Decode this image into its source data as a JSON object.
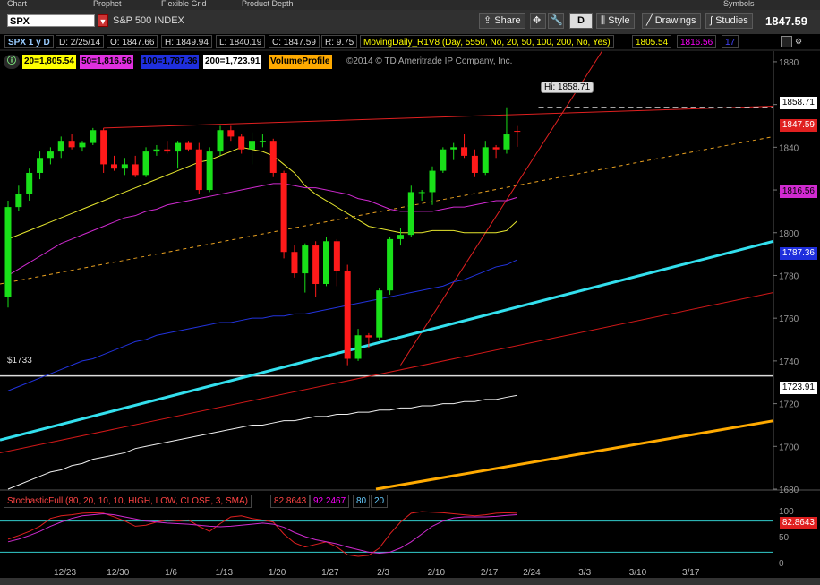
{
  "tabs": [
    "Chart",
    "Prophet",
    "Flexible Grid",
    "Product Depth",
    "Symbols"
  ],
  "toolbar": {
    "symbol": "SPX",
    "symbol_name": "S&P 500 INDEX",
    "share_label": "Share",
    "d_label": "D",
    "style_label": "Style",
    "drawings_label": "Drawings",
    "studies_label": "Studies",
    "last_price": "1847.59"
  },
  "infobar": {
    "symbol_period": "SPX 1 y D",
    "date": "D: 2/25/14",
    "open": "O: 1847.66",
    "high": "H: 1849.94",
    "low": "L: 1840.19",
    "close": "C: 1847.59",
    "range": "R: 9.75",
    "study": "MovingDaily_R1V8 (Day, 5550, No, 20, 50, 100, 200, No, Yes)",
    "ma_a": "1805.54",
    "ma_b": "1816.56",
    "ma_c": "17"
  },
  "study_labels": {
    "ma20": "20=1,805.54",
    "ma50": "50=1,816.56",
    "ma100": "100=1,787.36",
    "ma200": "200=1,723.91",
    "volume_profile": "VolumeProfile",
    "copyright": "©2014 © TD Ameritrade IP Company, Inc."
  },
  "annotations": {
    "high_bubble": "Hi: 1858.71",
    "level_label": "$1733"
  },
  "price_labels": {
    "hi": "1858.71",
    "last": "1847.59",
    "ma50": "1816.56",
    "ma100": "1787.36",
    "ma200": "1723.91",
    "stoch": "82.8643"
  },
  "stochastic": {
    "name": "StochasticFull (80, 20, 10, 10, HIGH, LOW, CLOSE, 3, SMA)",
    "k": "82.8643",
    "d": "92.2467",
    "over_bought": "80",
    "over_sold": "20"
  },
  "colors": {
    "up": "#19e019",
    "down": "#ff1a1a",
    "ma20": "#e6e62e",
    "ma50": "#d02ad0",
    "ma100": "#2233dd",
    "ma200": "#f0f0f0",
    "cyan": "#33e0ee",
    "orange": "#ffaa00"
  },
  "chart_data": {
    "type": "candlestick",
    "symbol": "SPX",
    "ylim": [
      1680,
      1885
    ],
    "y_ticks": [
      1680,
      1700,
      1720,
      1740,
      1760,
      1780,
      1800,
      1820,
      1840,
      1860,
      1880
    ],
    "x_tick_labels": [
      "12/23",
      "12/30",
      "1/6",
      "1/13",
      "1/20",
      "1/27",
      "2/3",
      "2/10",
      "2/17",
      "2/24",
      "3/3",
      "3/10",
      "3/17"
    ],
    "candles": [
      {
        "o": 1770,
        "c": 1812,
        "h": 1815,
        "l": 1765
      },
      {
        "o": 1812,
        "c": 1818,
        "h": 1822,
        "l": 1810
      },
      {
        "o": 1818,
        "c": 1828,
        "h": 1830,
        "l": 1815
      },
      {
        "o": 1828,
        "c": 1835,
        "h": 1838,
        "l": 1825
      },
      {
        "o": 1835,
        "c": 1838,
        "h": 1840,
        "l": 1832
      },
      {
        "o": 1838,
        "c": 1843,
        "h": 1845,
        "l": 1835
      },
      {
        "o": 1843,
        "c": 1840,
        "h": 1846,
        "l": 1839
      },
      {
        "o": 1840,
        "c": 1842,
        "h": 1843,
        "l": 1838
      },
      {
        "o": 1842,
        "c": 1848,
        "h": 1849,
        "l": 1841
      },
      {
        "o": 1848,
        "c": 1832,
        "h": 1849,
        "l": 1828
      },
      {
        "o": 1832,
        "c": 1830,
        "h": 1836,
        "l": 1829
      },
      {
        "o": 1830,
        "c": 1832,
        "h": 1835,
        "l": 1827
      },
      {
        "o": 1832,
        "c": 1827,
        "h": 1836,
        "l": 1826
      },
      {
        "o": 1827,
        "c": 1838,
        "h": 1840,
        "l": 1826
      },
      {
        "o": 1838,
        "c": 1839,
        "h": 1841,
        "l": 1836
      },
      {
        "o": 1839,
        "c": 1838,
        "h": 1843,
        "l": 1837
      },
      {
        "o": 1838,
        "c": 1842,
        "h": 1843,
        "l": 1830
      },
      {
        "o": 1842,
        "c": 1839,
        "h": 1843,
        "l": 1838
      },
      {
        "o": 1839,
        "c": 1820,
        "h": 1842,
        "l": 1818
      },
      {
        "o": 1820,
        "c": 1838,
        "h": 1840,
        "l": 1819
      },
      {
        "o": 1838,
        "c": 1848,
        "h": 1850,
        "l": 1836
      },
      {
        "o": 1848,
        "c": 1845,
        "h": 1850,
        "l": 1843
      },
      {
        "o": 1845,
        "c": 1839,
        "h": 1846,
        "l": 1837
      },
      {
        "o": 1839,
        "c": 1843,
        "h": 1847,
        "l": 1832
      },
      {
        "o": 1843,
        "c": 1843,
        "h": 1846,
        "l": 1840
      },
      {
        "o": 1843,
        "c": 1828,
        "h": 1844,
        "l": 1826
      },
      {
        "o": 1828,
        "c": 1791,
        "h": 1829,
        "l": 1788
      },
      {
        "o": 1791,
        "c": 1781,
        "h": 1794,
        "l": 1779
      },
      {
        "o": 1781,
        "c": 1794,
        "h": 1795,
        "l": 1772
      },
      {
        "o": 1794,
        "c": 1776,
        "h": 1796,
        "l": 1770
      },
      {
        "o": 1776,
        "c": 1796,
        "h": 1798,
        "l": 1775
      },
      {
        "o": 1796,
        "c": 1782,
        "h": 1797,
        "l": 1775
      },
      {
        "o": 1782,
        "c": 1741,
        "h": 1785,
        "l": 1738
      },
      {
        "o": 1741,
        "c": 1752,
        "h": 1755,
        "l": 1740
      },
      {
        "o": 1752,
        "c": 1751,
        "h": 1753,
        "l": 1746
      },
      {
        "o": 1751,
        "c": 1773,
        "h": 1774,
        "l": 1750
      },
      {
        "o": 1773,
        "c": 1797,
        "h": 1798,
        "l": 1771
      },
      {
        "o": 1797,
        "c": 1799,
        "h": 1802,
        "l": 1794
      },
      {
        "o": 1799,
        "c": 1819,
        "h": 1822,
        "l": 1798
      },
      {
        "o": 1819,
        "c": 1819,
        "h": 1820,
        "l": 1815
      },
      {
        "o": 1819,
        "c": 1829,
        "h": 1831,
        "l": 1813
      },
      {
        "o": 1829,
        "c": 1839,
        "h": 1840,
        "l": 1828
      },
      {
        "o": 1839,
        "c": 1840,
        "h": 1842,
        "l": 1834
      },
      {
        "o": 1840,
        "c": 1836,
        "h": 1846,
        "l": 1835
      },
      {
        "o": 1836,
        "c": 1828,
        "h": 1839,
        "l": 1826
      },
      {
        "o": 1828,
        "c": 1840,
        "h": 1843,
        "l": 1827
      },
      {
        "o": 1840,
        "c": 1839,
        "h": 1841,
        "l": 1835
      },
      {
        "o": 1839,
        "c": 1846,
        "h": 1858.71,
        "l": 1837
      },
      {
        "o": 1847.66,
        "c": 1847.59,
        "h": 1849.94,
        "l": 1840.19
      }
    ],
    "moving_averages": [
      {
        "name": "20",
        "values": [
          1797,
          1799,
          1801,
          1803,
          1805,
          1807,
          1809,
          1811,
          1813,
          1815,
          1817,
          1819,
          1821,
          1823,
          1825,
          1827,
          1829,
          1831,
          1833,
          1834,
          1836,
          1838,
          1840,
          1839,
          1838,
          1836,
          1832,
          1828,
          1822,
          1818,
          1815,
          1812,
          1809,
          1806,
          1803,
          1802,
          1801,
          1800,
          1800,
          1800,
          1801,
          1801,
          1801,
          1800,
          1800,
          1800,
          1800,
          1801,
          1805.54
        ]
      },
      {
        "name": "50",
        "values": [
          1780,
          1783,
          1786,
          1789,
          1792,
          1795,
          1797,
          1799,
          1801,
          1803,
          1805,
          1807,
          1808,
          1810,
          1811,
          1813,
          1814,
          1815,
          1816,
          1817,
          1818,
          1819,
          1820,
          1821,
          1822,
          1823,
          1823,
          1822,
          1821,
          1821,
          1820,
          1819,
          1818,
          1816,
          1815,
          1813,
          1811,
          1810,
          1810,
          1810,
          1810,
          1811,
          1812,
          1812,
          1813,
          1814,
          1815,
          1815,
          1816.56
        ]
      },
      {
        "name": "100",
        "values": [
          1726,
          1728,
          1730,
          1732,
          1734,
          1736,
          1738,
          1740,
          1741,
          1743,
          1745,
          1747,
          1749,
          1750,
          1752,
          1753,
          1754,
          1755,
          1756,
          1757,
          1758,
          1758,
          1759,
          1760,
          1760,
          1761,
          1761,
          1762,
          1762,
          1763,
          1764,
          1765,
          1766,
          1767,
          1768,
          1769,
          1770,
          1771,
          1772,
          1773,
          1774,
          1775,
          1777,
          1778,
          1780,
          1782,
          1784,
          1785,
          1787.36
        ]
      },
      {
        "name": "200",
        "values": [
          1680,
          1682,
          1684,
          1686,
          1688,
          1689,
          1691,
          1692,
          1694,
          1695,
          1696,
          1697,
          1699,
          1700,
          1701,
          1702,
          1703,
          1704,
          1705,
          1706,
          1707,
          1708,
          1709,
          1710,
          1710,
          1711,
          1712,
          1712,
          1713,
          1714,
          1714,
          1715,
          1715,
          1716,
          1716,
          1717,
          1717,
          1718,
          1718,
          1719,
          1719,
          1720,
          1720,
          1721,
          1721,
          1722,
          1722,
          1723,
          1723.91
        ]
      }
    ],
    "stochastic": {
      "ylim": [
        0,
        100
      ],
      "levels": [
        80,
        20
      ],
      "k": [
        45,
        52,
        60,
        70,
        85,
        90,
        92,
        95,
        96,
        95,
        88,
        80,
        70,
        72,
        78,
        82,
        80,
        82,
        70,
        60,
        75,
        88,
        90,
        85,
        82,
        78,
        55,
        38,
        30,
        35,
        40,
        30,
        15,
        12,
        14,
        28,
        55,
        78,
        95,
        98,
        97,
        96,
        94,
        92,
        90,
        92,
        95,
        96,
        95
      ],
      "d": [
        40,
        45,
        52,
        60,
        70,
        78,
        85,
        90,
        92,
        94,
        92,
        88,
        84,
        80,
        78,
        76,
        75,
        74,
        72,
        70,
        69,
        70,
        72,
        74,
        76,
        74,
        68,
        58,
        50,
        44,
        40,
        36,
        30,
        25,
        20,
        18,
        20,
        28,
        40,
        55,
        70,
        80,
        86,
        88,
        88,
        88,
        89,
        91,
        92.25
      ]
    }
  }
}
